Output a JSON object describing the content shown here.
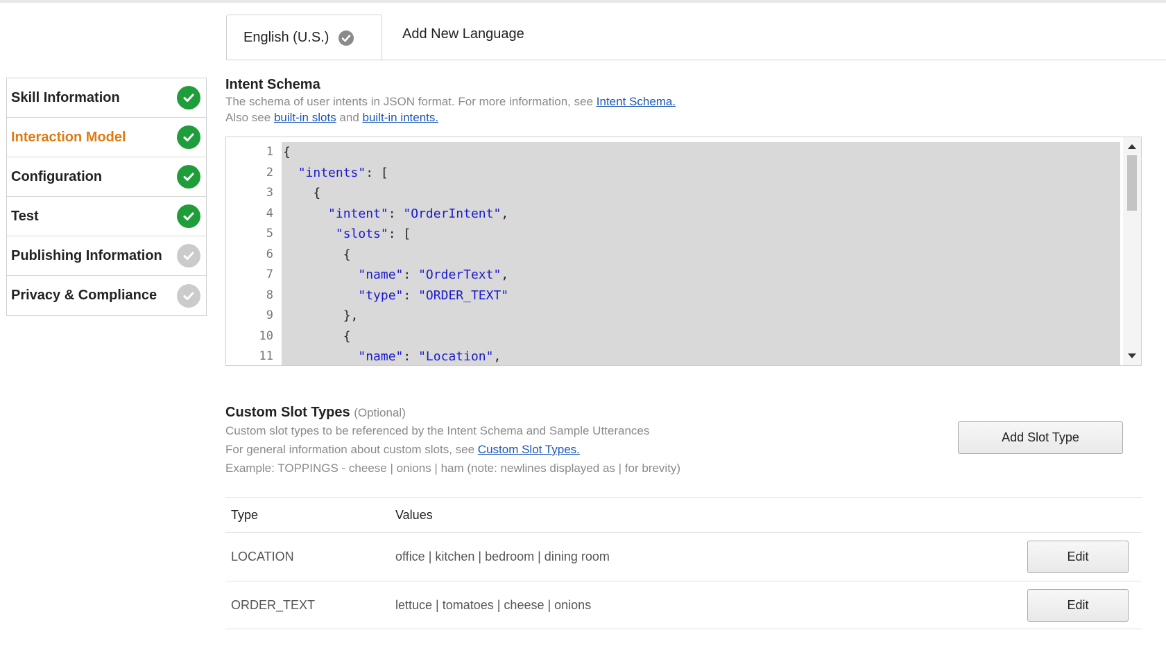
{
  "tabs": {
    "active_label": "English (U.S.)",
    "add_label": "Add New Language"
  },
  "sidebar": {
    "items": [
      {
        "label": "Skill Information",
        "status": "complete"
      },
      {
        "label": "Interaction Model",
        "status": "complete",
        "active": true
      },
      {
        "label": "Configuration",
        "status": "complete"
      },
      {
        "label": "Test",
        "status": "complete"
      },
      {
        "label": "Publishing Information",
        "status": "incomplete"
      },
      {
        "label": "Privacy & Compliance",
        "status": "incomplete"
      }
    ]
  },
  "intent_schema": {
    "title": "Intent Schema",
    "desc_line1_prefix": "The schema of user intents in JSON format. For more information, see ",
    "desc_line1_link": "Intent Schema.",
    "desc_line2_prefix": "Also see ",
    "desc_line2_link1": "built-in slots",
    "desc_line2_mid": " and ",
    "desc_line2_link2": "built-in intents.",
    "line_numbers": [
      "1",
      "2",
      "3",
      "4",
      "5",
      "6",
      "7",
      "8",
      "9",
      "10",
      "11"
    ]
  },
  "custom_slots": {
    "title": "Custom Slot Types",
    "optional": "(Optional)",
    "desc_line1": "Custom slot types to be referenced by the Intent Schema and Sample Utterances",
    "desc_line2_prefix": "For general information about custom slots, see ",
    "desc_line2_link": "Custom Slot Types.",
    "desc_line3": "Example: TOPPINGS - cheese | onions | ham (note: newlines displayed as | for brevity)",
    "add_button": "Add Slot Type",
    "col_type": "Type",
    "col_values": "Values",
    "rows": [
      {
        "type": "LOCATION",
        "values": "office | kitchen | bedroom | dining room",
        "edit": "Edit"
      },
      {
        "type": "ORDER_TEXT",
        "values": "lettuce | tomatoes | cheese | onions",
        "edit": "Edit"
      }
    ]
  },
  "colors": {
    "active_nav": "#e07b14",
    "complete": "#1f9d3a",
    "incomplete": "#cbcbcb",
    "link": "#1a57b8",
    "json_string": "#1a1acd"
  }
}
